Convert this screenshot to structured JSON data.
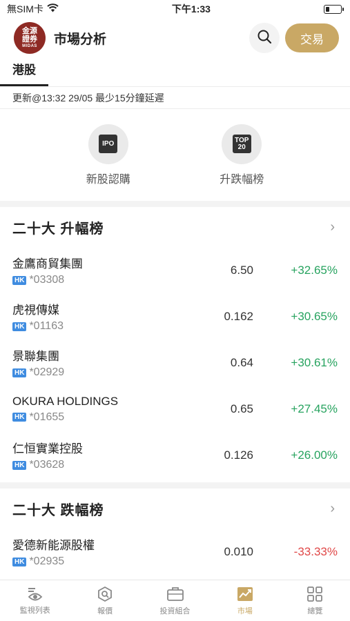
{
  "status_bar": {
    "carrier": "無SIM卡",
    "time": "下午1:33"
  },
  "header": {
    "logo_text_top": "金源",
    "logo_text_mid": "證券",
    "logo_text_bottom": "MIDAS",
    "title": "市場分析",
    "trade_label": "交易"
  },
  "tabs": [
    {
      "label": "港股"
    }
  ],
  "update_text": "更新@13:32 29/05 最少15分鐘延遲",
  "shortcuts": [
    {
      "label": "新股認購",
      "icon": "ipo-icon",
      "icon_text": "IPO"
    },
    {
      "label": "升跌幅榜",
      "icon": "top20-icon",
      "icon_text_top": "TOP",
      "icon_text_bottom": "20"
    }
  ],
  "gainers": {
    "title": "二十大 升幅榜",
    "rows": [
      {
        "name": "金鷹商貿集團",
        "badge": "HK",
        "code": "*03308",
        "price": "6.50",
        "change": "+32.65%"
      },
      {
        "name": "虎視傳媒",
        "badge": "HK",
        "code": "*01163",
        "price": "0.162",
        "change": "+30.65%"
      },
      {
        "name": "景聯集團",
        "badge": "HK",
        "code": "*02929",
        "price": "0.64",
        "change": "+30.61%"
      },
      {
        "name": "OKURA HOLDINGS",
        "badge": "HK",
        "code": "*01655",
        "price": "0.65",
        "change": "+27.45%"
      },
      {
        "name": "仁恒實業控股",
        "badge": "HK",
        "code": "*03628",
        "price": "0.126",
        "change": "+26.00%"
      }
    ]
  },
  "losers": {
    "title": "二十大 跌幅榜",
    "rows": [
      {
        "name": "愛德新能源股權",
        "badge": "HK",
        "code": "*02935",
        "price": "0.010",
        "change": "-33.33%"
      }
    ]
  },
  "bottom_nav": [
    {
      "label": "監視列表",
      "icon": "watchlist-icon"
    },
    {
      "label": "報價",
      "icon": "quote-icon"
    },
    {
      "label": "投資組合",
      "icon": "portfolio-icon"
    },
    {
      "label": "市場",
      "icon": "market-icon",
      "active": true
    },
    {
      "label": "總覽",
      "icon": "overview-icon"
    }
  ],
  "colors": {
    "accent": "#c9a865",
    "up": "#27a35f",
    "down": "#e04848",
    "badge": "#3f8ce0",
    "logo": "#8e2a24"
  }
}
